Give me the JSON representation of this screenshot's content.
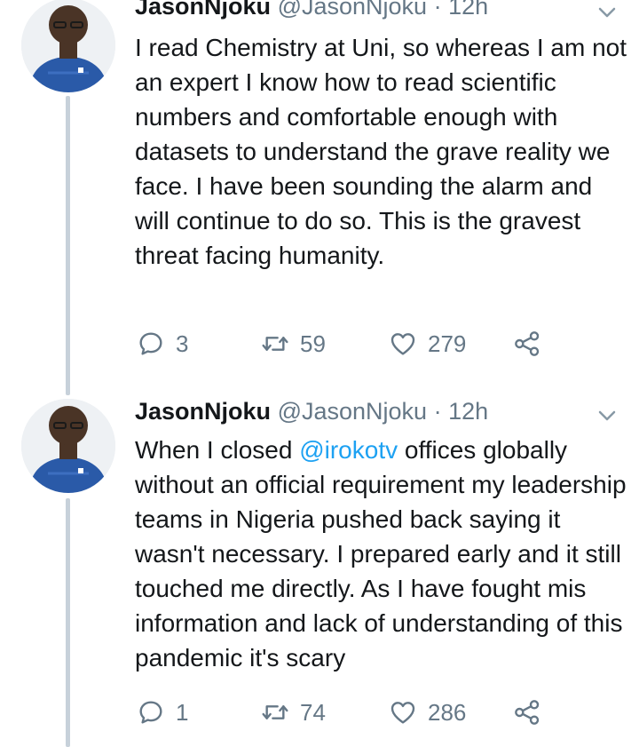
{
  "tweets": [
    {
      "name": "JasonNjoku",
      "handle": "@JasonNjoku",
      "separator": "·",
      "time": "12h",
      "text": "I read Chemistry at Uni, so whereas I am not an expert I know how to read scientific numbers and comfortable enough with datasets to understand the grave reality we face. I have been sounding the alarm and will continue to do so. This is the gravest threat facing humanity.",
      "replies": "3",
      "retweets": "59",
      "likes": "279"
    },
    {
      "name": "JasonNjoku",
      "handle": "@JasonNjoku",
      "separator": "·",
      "time": "12h",
      "text_before": "When I closed ",
      "mention": "@irokotv",
      "text_after": " offices globally without an official requirement my leadership teams in Nigeria pushed back saying it wasn't necessary. I prepared early and it still touched me directly. As I have fought mis information and lack of understanding of this pandemic it's scary",
      "replies": "1",
      "retweets": "74",
      "likes": "286"
    }
  ],
  "colors": {
    "accent": "#1da1f2",
    "text": "#14171a",
    "secondary": "#657786",
    "thread_line": "#c7d1da",
    "avatar_shirt": "#2a5aa8"
  },
  "icons": [
    "reply-icon",
    "retweet-icon",
    "like-icon",
    "share-icon",
    "chevron-down-icon"
  ]
}
